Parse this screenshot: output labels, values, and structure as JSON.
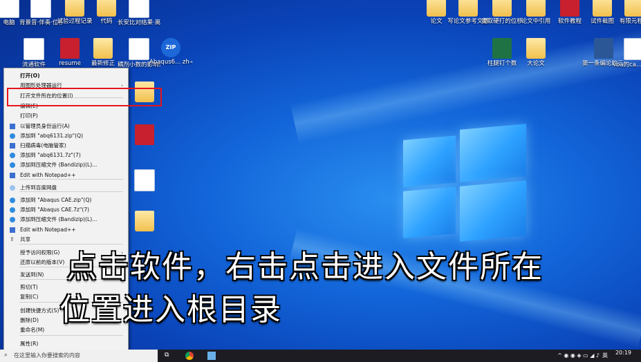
{
  "desktop_icons_top": [
    {
      "label": "电脑",
      "type": "doc"
    },
    {
      "label": "背景音·伴奏·位移图说和...",
      "type": "doc"
    },
    {
      "label": "试验过程记录",
      "type": "folder"
    },
    {
      "label": "代码",
      "type": "folder"
    },
    {
      "label": "长安比对结果·离散功影响",
      "type": "chart"
    },
    {
      "label": "论文",
      "type": "folder"
    },
    {
      "label": "写论文参考文献",
      "type": "folder"
    },
    {
      "label": "提取硬打的位移",
      "type": "folder"
    },
    {
      "label": "论文中引用",
      "type": "folder"
    },
    {
      "label": "软件教程",
      "type": "red"
    },
    {
      "label": "试件截图",
      "type": "folder"
    },
    {
      "label": "有限元程新",
      "type": "folder"
    }
  ],
  "desktop_icons_row2": [
    {
      "label": "流通软件",
      "type": "doc"
    },
    {
      "label": "resume",
      "type": "red"
    },
    {
      "label": "最新修正",
      "type": "folder"
    },
    {
      "label": "耦剂小数的影响修改",
      "type": "chart"
    },
    {
      "label": "Abaqus6... zh-cn lang...",
      "type": "zip"
    },
    {
      "label": "柱腿钉个数",
      "type": "excel"
    },
    {
      "label": "大论文",
      "type": "folder"
    },
    {
      "label": "第一条编论的三个内容",
      "type": "word"
    },
    {
      "label": "vba的ca... 次开发",
      "type": "doc"
    }
  ],
  "context_menu": {
    "items": [
      {
        "label": "打开(O)",
        "bold": true,
        "icon": ""
      },
      {
        "label": "用图形处理器运行",
        "icon": "",
        "arrow": true
      },
      {
        "label": "打开文件所在的位置(I)",
        "icon": "",
        "highlight": true
      },
      {
        "label": "编辑(E)",
        "icon": ""
      },
      {
        "label": "打印(P)",
        "icon": ""
      },
      {
        "label": "以管理员身份运行(A)",
        "icon": "shield"
      },
      {
        "label": "添加到 \"abq6131.zip\"(Q)",
        "icon": "bandizip"
      },
      {
        "label": "扫描病毒(电脑管家)",
        "icon": "shield"
      },
      {
        "label": "添加到 \"abq6131.7z\"(7)",
        "icon": "bandizip"
      },
      {
        "label": "添加到压缩文件 (Bandizip)(L)...",
        "icon": "bandizip"
      },
      {
        "label": "Edit with Notepad++",
        "icon": "notepad"
      },
      {
        "label": "上传到百度网盘",
        "icon": "cloud"
      },
      {
        "label": "添加到 \"Abaqus CAE.zip\"(Q)",
        "icon": "bandizip"
      },
      {
        "label": "添加到 \"Abaqus CAE.7z\"(7)",
        "icon": "bandizip"
      },
      {
        "label": "添加到压缩文件 (Bandizip)(L)...",
        "icon": "bandizip"
      },
      {
        "label": "Edit with Notepad++",
        "icon": "notepad"
      },
      {
        "label": "共享",
        "icon": "share"
      },
      {
        "label": "授予访问权限(G)",
        "icon": "",
        "arrow": true
      },
      {
        "label": "还原以前的版本(V)",
        "icon": ""
      },
      {
        "label": "发送到(N)",
        "icon": "",
        "arrow": true
      },
      {
        "label": "剪切(T)",
        "icon": ""
      },
      {
        "label": "复制(C)",
        "icon": ""
      },
      {
        "label": "创建快捷方式(S)",
        "icon": ""
      },
      {
        "label": "删除(D)",
        "icon": ""
      },
      {
        "label": "重命名(M)",
        "icon": ""
      },
      {
        "label": "属性(R)",
        "icon": ""
      }
    ]
  },
  "caption": {
    "line1": "点击软件，右击点击进入文件所在",
    "line2": "位置进入根目录"
  },
  "taskbar": {
    "search_placeholder": "在这里输入你要搜索的内容",
    "time": "20:19",
    "ime": "英"
  },
  "colors": {
    "highlight_box": "#e8141b",
    "desktop": "#0a43b8"
  }
}
